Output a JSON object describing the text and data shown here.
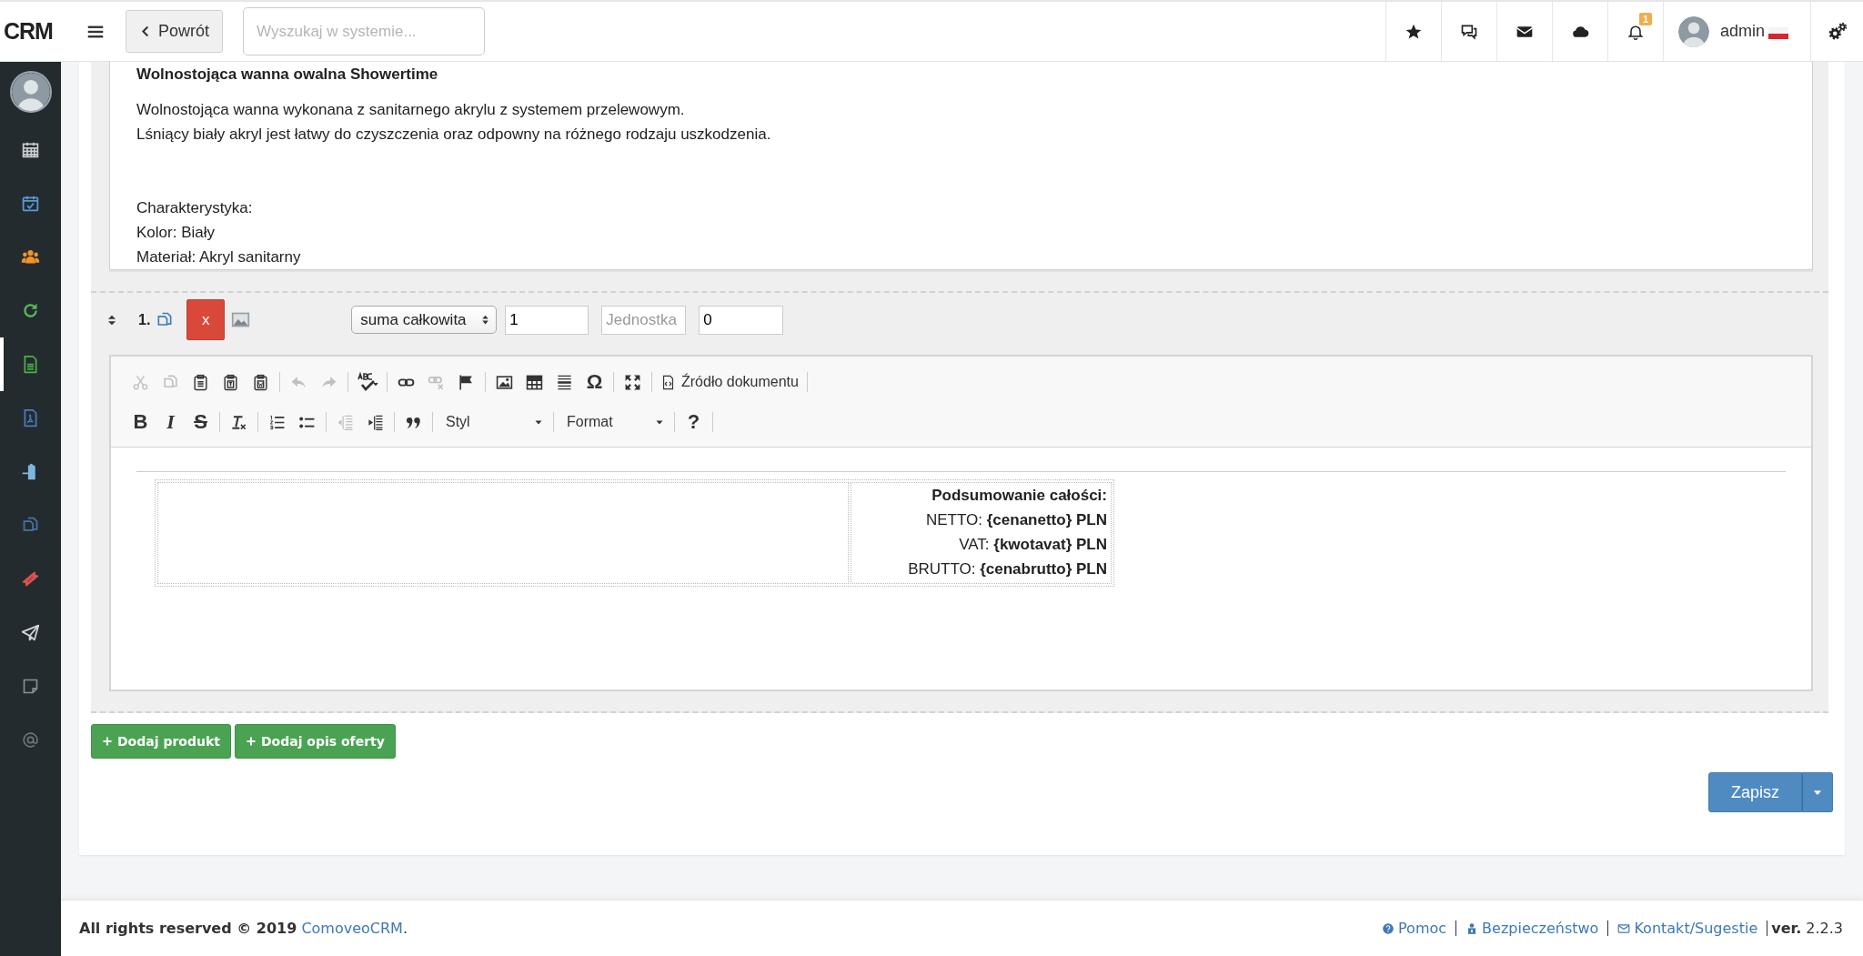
{
  "header": {
    "logo": "CRM",
    "back_button": "Powrót",
    "search": {
      "placeholder": "Wyszukaj w systemie..."
    },
    "actions": [
      {
        "kind": "star"
      },
      {
        "kind": "chat"
      },
      {
        "kind": "envelope"
      },
      {
        "kind": "cloud"
      },
      {
        "kind": "bell",
        "badge": "1"
      }
    ],
    "user": {
      "name": "admin"
    }
  },
  "sidebar": {
    "items": [
      {
        "kind": "calendar",
        "color": "#c8cdd0",
        "selected": false
      },
      {
        "kind": "calendar-check",
        "color": "#5b9bd5",
        "selected": false
      },
      {
        "kind": "users",
        "color": "#f0932b",
        "selected": false
      },
      {
        "kind": "refresh",
        "color": "#5cb85c",
        "selected": false
      },
      {
        "kind": "doc",
        "color": "#4cae4c",
        "selected": true
      },
      {
        "kind": "pdf",
        "color": "#4a7bb7",
        "selected": false
      },
      {
        "kind": "clipboard",
        "color": "#7fb6e0",
        "selected": false
      },
      {
        "kind": "copy",
        "color": "#4a72a8",
        "selected": false
      },
      {
        "kind": "ticket",
        "color": "#d9534f",
        "selected": false
      },
      {
        "kind": "plane",
        "color": "#d5d9dc",
        "selected": false
      },
      {
        "kind": "note",
        "color": "#8a9296",
        "selected": false
      },
      {
        "kind": "at",
        "color": "#6f777b",
        "selected": false
      }
    ]
  },
  "description": {
    "title": "Wolnostojąca wanna owalna Showertime",
    "blocks": [
      [
        "Wolnostojąca wanna wykonana z sanitarnego akrylu z systemem przelewowym.",
        "Lśniący biały akryl jest łatwy do czyszczenia oraz odpowny na różnego rodzaju uszkodzenia."
      ],
      [
        "Charakterystyka:",
        "Kolor: Biały",
        "Materiał: Akryl sanitarny"
      ]
    ]
  },
  "product_row": {
    "number": "1.",
    "delete_label": "x",
    "amount_type": "suma całkowita",
    "quantity": "1",
    "unit": {
      "placeholder": "Jednostka"
    },
    "price": "0"
  },
  "editor": {
    "toolbar": [
      [
        [
          {
            "kind": "cut",
            "disabled": true
          },
          {
            "kind": "copy",
            "disabled": true
          },
          {
            "kind": "paste",
            "disabled": false
          },
          {
            "kind": "paste-text",
            "disabled": false
          },
          {
            "kind": "paste-word",
            "disabled": false
          }
        ],
        [
          {
            "kind": "undo",
            "disabled": true
          },
          {
            "kind": "redo",
            "disabled": true
          }
        ],
        [
          {
            "kind": "spellcheck",
            "disabled": false
          }
        ],
        [
          {
            "kind": "link",
            "disabled": false
          },
          {
            "kind": "unlink",
            "disabled": true
          },
          {
            "kind": "anchor",
            "disabled": false
          }
        ],
        [
          {
            "kind": "image",
            "disabled": false
          },
          {
            "kind": "table",
            "disabled": false
          },
          {
            "kind": "hr",
            "disabled": false
          },
          {
            "kind": "char",
            "label": "Ω",
            "disabled": false
          }
        ],
        [
          {
            "kind": "maximize",
            "disabled": false
          }
        ],
        [
          {
            "kind": "source",
            "label": "Źródło dokumentu",
            "disabled": false
          }
        ]
      ],
      [
        [
          {
            "kind": "bold",
            "label": "B",
            "disabled": false
          },
          {
            "kind": "italic",
            "label": "I",
            "disabled": false
          },
          {
            "kind": "strike",
            "label": "S",
            "disabled": false
          }
        ],
        [
          {
            "kind": "removeformat",
            "disabled": false
          }
        ],
        [
          {
            "kind": "ol",
            "disabled": false
          },
          {
            "kind": "ul",
            "disabled": false
          }
        ],
        [
          {
            "kind": "outdent",
            "disabled": true
          },
          {
            "kind": "indent",
            "disabled": false
          }
        ],
        [
          {
            "kind": "quote",
            "disabled": false
          }
        ],
        [
          {
            "kind": "combo",
            "label": "Styl",
            "disabled": false
          }
        ],
        [
          {
            "kind": "combo",
            "label": "Format",
            "disabled": false
          }
        ],
        [
          {
            "kind": "char",
            "label": "?",
            "disabled": false
          }
        ]
      ]
    ],
    "summary": {
      "title": "Podsumowanie całości:",
      "lines": [
        "NETTO: **{cenanetto} PLN**",
        "VAT: **{kwotavat} PLN**",
        "BRUTTO: **{cenabrutto} PLN**"
      ]
    }
  },
  "add_buttons": [
    "Dodaj produkt",
    "Dodaj opis oferty"
  ],
  "save_button": "Zapisz",
  "footer": {
    "copyright": "All rights reserved © 2019",
    "brand_link": "ComoveoCRM",
    "end": ".",
    "links": [
      {
        "kind": "help",
        "label": "Pomoc"
      },
      {
        "kind": "lock",
        "label": "Bezpieczeństwo"
      },
      {
        "kind": "envelope",
        "label": "Kontakt/Sugestie"
      }
    ],
    "version": "**ver.** 2.2.3"
  }
}
